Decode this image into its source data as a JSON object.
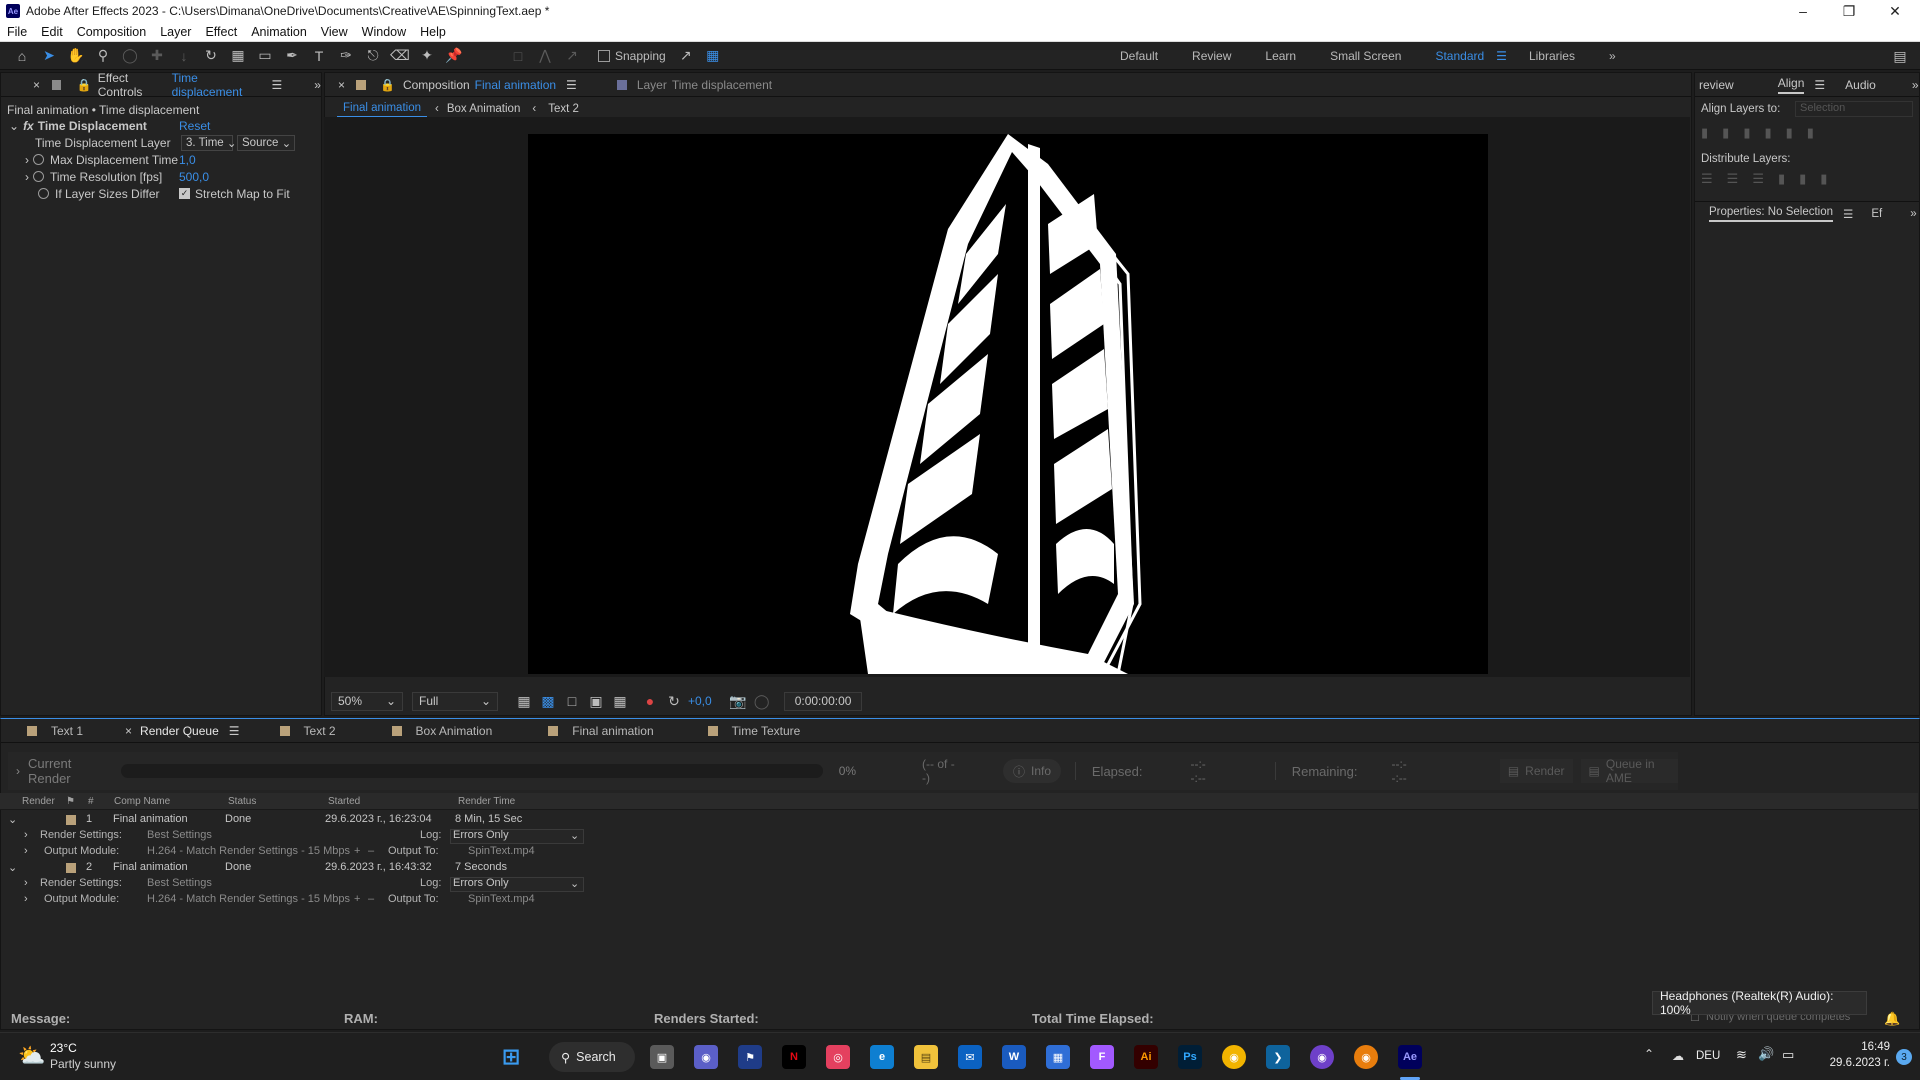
{
  "window": {
    "title": "Adobe After Effects 2023 - C:\\Users\\Dimana\\OneDrive\\Documents\\Creative\\AE\\SpinningText.aep *",
    "app_icon": "Ae"
  },
  "menu": [
    "File",
    "Edit",
    "Composition",
    "Layer",
    "Effect",
    "Animation",
    "View",
    "Window",
    "Help"
  ],
  "toolbar": {
    "snapping_label": "Snapping",
    "workspaces": [
      "Default",
      "Review",
      "Learn",
      "Small Screen",
      "Standard",
      "Libraries"
    ],
    "active_workspace": "Standard"
  },
  "effect_controls": {
    "tab_label": "Effect Controls",
    "tab_layer": "Time displacement",
    "breadcrumb": "Final animation • Time displacement",
    "effect_name": "Time Displacement",
    "reset_label": "Reset",
    "props": {
      "layer_label": "Time Displacement Layer",
      "layer_value": "3. Time",
      "layer_source": "Source",
      "max_label": "Max Displacement Time",
      "max_value": "1,0",
      "res_label": "Time Resolution [fps]",
      "res_value": "500,0",
      "sizes_label": "If Layer Sizes Differ",
      "stretch_label": "Stretch Map to Fit"
    }
  },
  "composition": {
    "tab_label": "Composition",
    "tab_name": "Final animation",
    "layer_tab_label": "Layer",
    "layer_tab_name": "Time displacement",
    "breadcrumbs": [
      "Final animation",
      "Box Animation",
      "Text 2"
    ],
    "zoom": "50%",
    "resolution": "Full",
    "exposure": "+0,0",
    "timecode": "0:00:00:00"
  },
  "right_panel": {
    "tabs": [
      "review",
      "Align",
      "Audio"
    ],
    "align_to_label": "Align Layers to:",
    "align_to_value": "Selection",
    "distribute_label": "Distribute Layers:",
    "props_tab": "Properties: No Selection",
    "props_tab2": "Ef"
  },
  "bottom_tabs": [
    "Text 1",
    "Render Queue",
    "Text 2",
    "Box Animation",
    "Final animation",
    "Time Texture"
  ],
  "render_queue": {
    "current_render_label": "Current Render",
    "percent": "0%",
    "of": "(-- of --)",
    "info": "Info",
    "elapsed_label": "Elapsed:",
    "elapsed_value": "--:--:--",
    "remaining_label": "Remaining:",
    "remaining_value": "--:--:--",
    "render_button": "Render",
    "ame_button": "Queue in AME",
    "columns": [
      "Render",
      "#",
      "Comp Name",
      "Status",
      "Started",
      "Render Time"
    ],
    "items": [
      {
        "num": "1",
        "comp": "Final animation",
        "status": "Done",
        "started": "29.6.2023 г., 16:23:04",
        "time": "8 Min, 15 Sec",
        "render_settings_label": "Render Settings:",
        "render_settings": "Best Settings",
        "log_label": "Log:",
        "log_value": "Errors Only",
        "output_module_label": "Output Module:",
        "output_module": "H.264 - Match Render Settings - 15 Mbps",
        "output_to_label": "Output To:",
        "output_to": "SpinText.mp4"
      },
      {
        "num": "2",
        "comp": "Final animation",
        "status": "Done",
        "started": "29.6.2023 г., 16:43:32",
        "time": "7 Seconds",
        "render_settings_label": "Render Settings:",
        "render_settings": "Best Settings",
        "log_label": "Log:",
        "log_value": "Errors Only",
        "output_module_label": "Output Module:",
        "output_module": "H.264 - Match Render Settings - 15 Mbps",
        "output_to_label": "Output To:",
        "output_to": "SpinText.mp4"
      }
    ],
    "footer": {
      "message": "Message:",
      "ram": "RAM:",
      "renders_started": "Renders Started:",
      "total_elapsed": "Total Time Elapsed:",
      "notify": "Notify when queue completes"
    }
  },
  "tooltip": "Headphones (Realtek(R) Audio): 100%",
  "taskbar": {
    "temp": "23°C",
    "weather": "Partly sunny",
    "search": "Search",
    "lang": "DEU",
    "time": "16:49",
    "date": "29.6.2023 г.",
    "notif_count": "3"
  },
  "colors": {
    "accent": "#3a8ee6",
    "panel_bg": "#232323",
    "label_swatch": "#b9a17a"
  }
}
